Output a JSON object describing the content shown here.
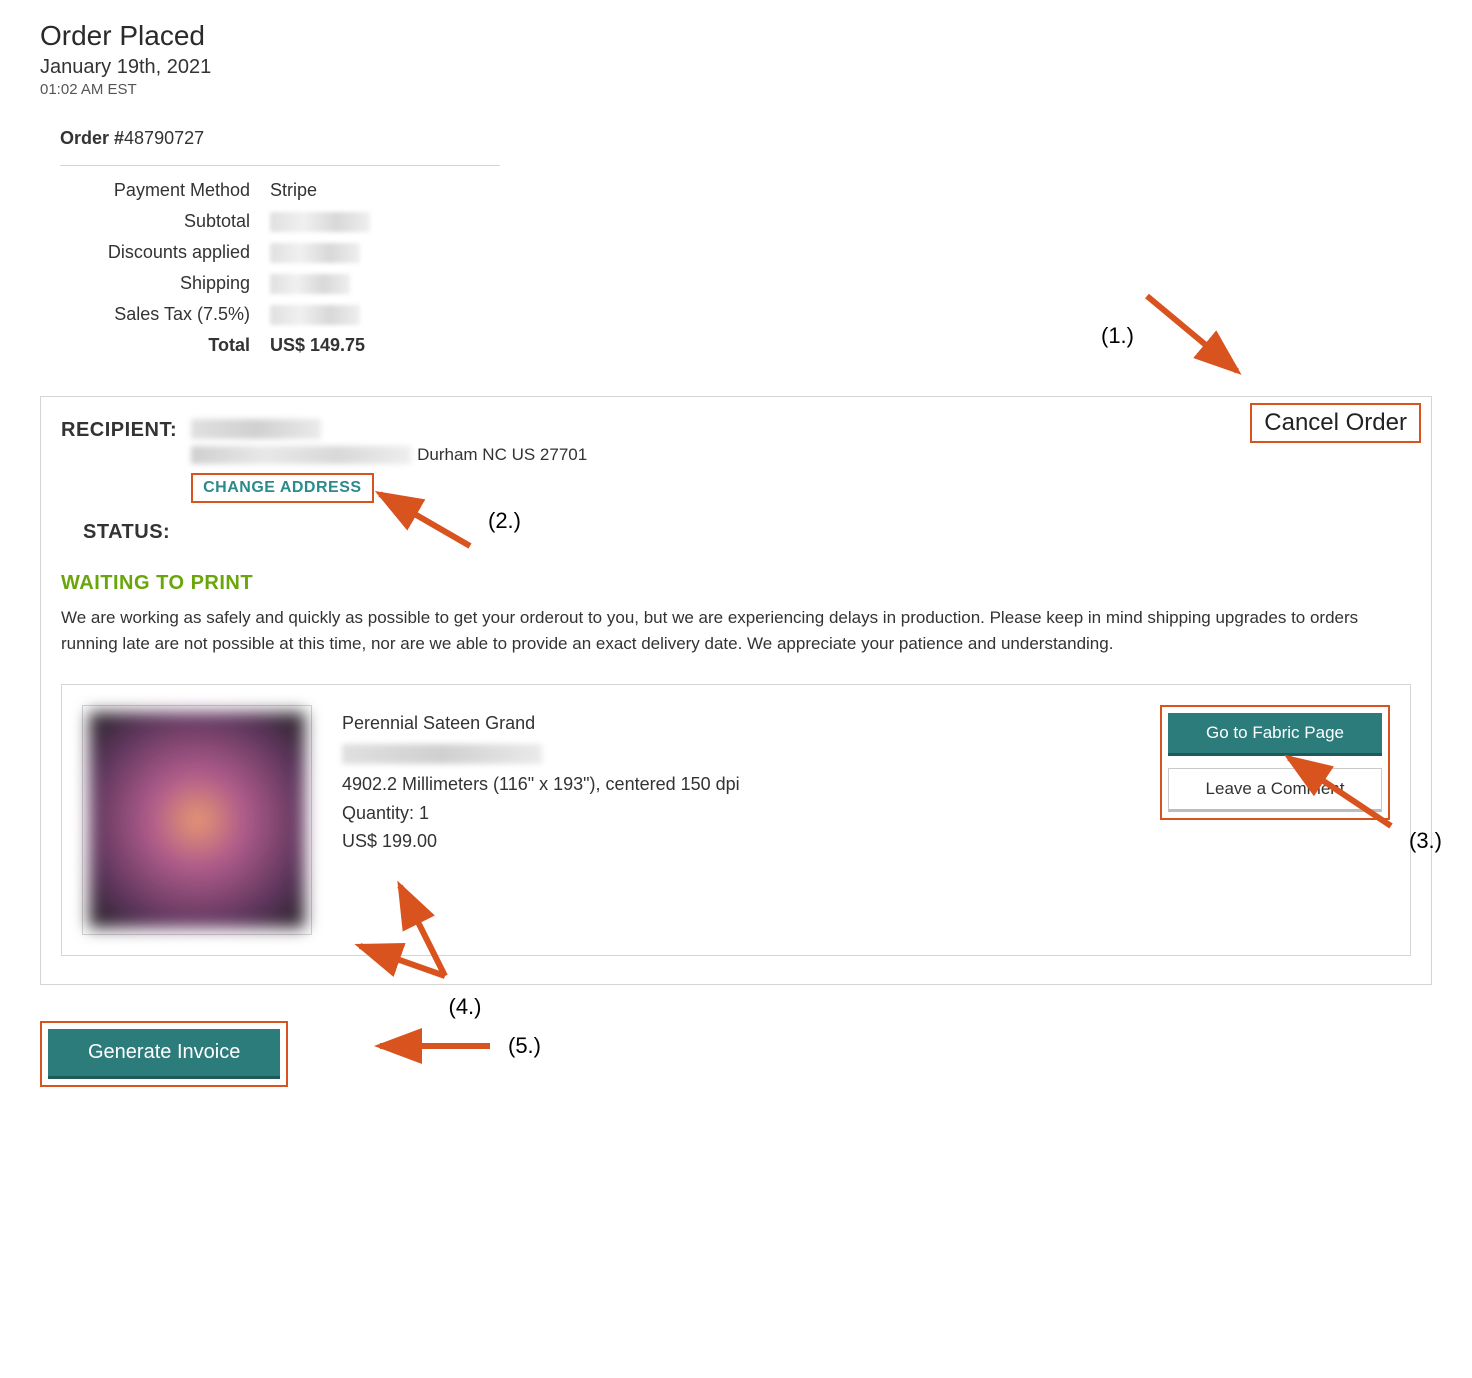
{
  "header": {
    "title": "Order Placed",
    "date": "January 19th, 2021",
    "time": "01:02 AM EST"
  },
  "order": {
    "number_label": "Order #",
    "number": "48790727",
    "rows": {
      "payment_method": {
        "label": "Payment Method",
        "value": "Stripe"
      },
      "subtotal": {
        "label": "Subtotal"
      },
      "discounts": {
        "label": "Discounts applied"
      },
      "shipping": {
        "label": "Shipping"
      },
      "tax": {
        "label": "Sales Tax (7.5%)"
      },
      "total": {
        "label": "Total",
        "value": "US$ 149.75"
      }
    }
  },
  "details": {
    "recipient_label": "RECIPIENT:",
    "address_suffix": "Durham NC US 27701",
    "change_address": "CHANGE ADDRESS",
    "cancel_order": "Cancel Order",
    "status_label": "STATUS:",
    "status_value": "WAITING TO PRINT",
    "status_desc": "We are working as safely and quickly as possible to get your orderout to you, but we are experiencing delays in production. Please keep in mind shipping upgrades to orders running late are not possible at this time, nor are we able to provide an exact delivery date. We appreciate your patience and understanding."
  },
  "item": {
    "name": "Perennial Sateen Grand",
    "dims": "4902.2 Millimeters (116\" x 193\"), centered 150 dpi",
    "qty": "Quantity: 1",
    "price": "US$ 199.00",
    "go_fabric": "Go to Fabric Page",
    "leave_comment": "Leave a Comment"
  },
  "footer": {
    "generate_invoice": "Generate Invoice"
  },
  "annotations": {
    "a1": "(1.)",
    "a2": "(2.)",
    "a3": "(3.)",
    "a4": "(4.)",
    "a5": "(5.)"
  }
}
